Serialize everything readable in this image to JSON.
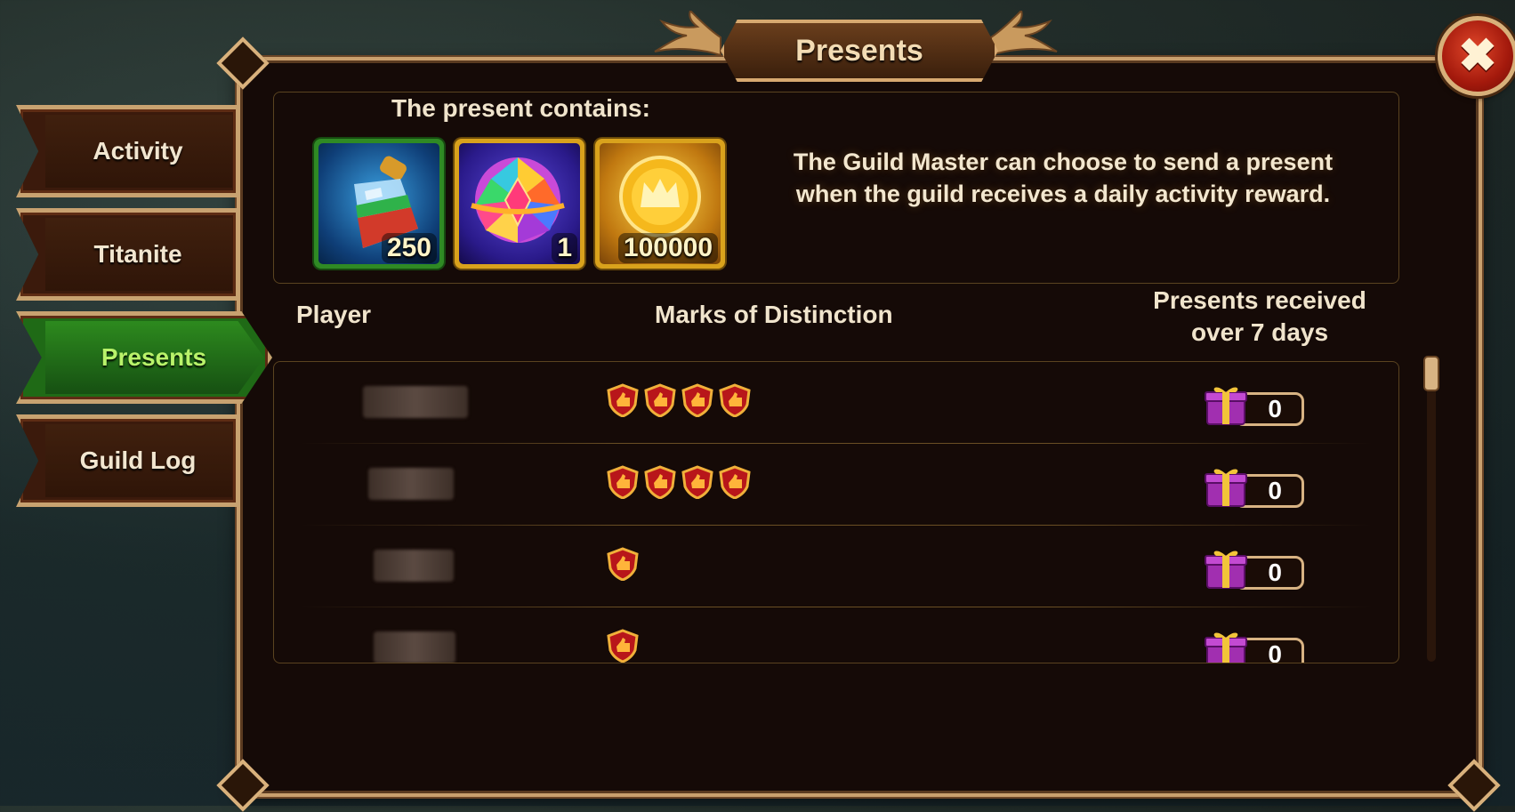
{
  "window": {
    "title": "Presents",
    "close_icon": "close-icon"
  },
  "sidebar": {
    "tabs": [
      {
        "label": "Activity",
        "active": false
      },
      {
        "label": "Titanite",
        "active": false
      },
      {
        "label": "Presents",
        "active": true
      },
      {
        "label": "Guild Log",
        "active": false
      }
    ]
  },
  "present": {
    "heading": "The present contains:",
    "items": [
      {
        "icon": "potion-bottle-icon",
        "count": "250"
      },
      {
        "icon": "gem-sphere-icon",
        "count": "1"
      },
      {
        "icon": "gold-coin-icon",
        "count": "100000"
      }
    ],
    "description": "The Guild Master can choose to send a present when the guild receives a daily activity reward."
  },
  "table": {
    "headers": {
      "player": "Player",
      "marks": "Marks of Distinction",
      "presents": "Presents received over 7 days"
    },
    "rows": [
      {
        "player": "",
        "marks": 4,
        "presents": "0"
      },
      {
        "player": "",
        "marks": 4,
        "presents": "0"
      },
      {
        "player": "",
        "marks": 1,
        "presents": "0"
      },
      {
        "player": "",
        "marks": 1,
        "presents": "0"
      }
    ]
  },
  "colors": {
    "panel_bg": "#150a07",
    "border_gold": "#c9a06e",
    "active_tab_green": "#1f6a16",
    "active_tab_text": "#b9f36a"
  }
}
